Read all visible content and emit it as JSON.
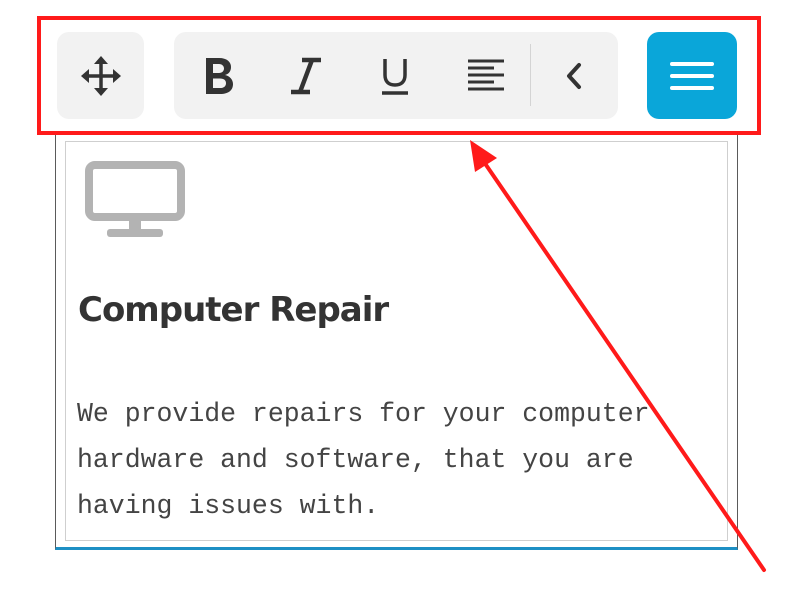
{
  "toolbar": {
    "buttons": [
      {
        "name": "move",
        "icon": "move-icon",
        "interactable": true
      },
      {
        "name": "bold",
        "icon": "bold-icon"
      },
      {
        "name": "italic",
        "icon": "italic-icon"
      },
      {
        "name": "underline",
        "icon": "underline-icon"
      },
      {
        "name": "align",
        "icon": "align-left-icon"
      },
      {
        "name": "collapse",
        "icon": "chevron-left-icon"
      },
      {
        "name": "menu",
        "icon": "hamburger-menu-icon"
      }
    ],
    "menu_button_color": "#0aa6d9"
  },
  "card": {
    "icon": "desktop-monitor-icon",
    "title": "Computer Repair",
    "text": "We provide repairs for your computer hardware and software, that you are having issues with.",
    "accent_color": "#1d8fc4"
  },
  "annotation": {
    "highlight_color": "#ff1a1a",
    "target": "toolbar"
  }
}
